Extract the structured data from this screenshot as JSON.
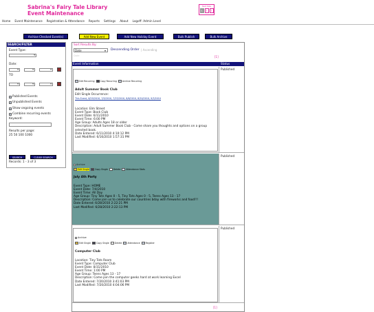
{
  "header": {
    "title_line1": "Sabrina's Fairy Tale Library",
    "title_line2": "Event Maintenance",
    "text_size_label": "Text Size",
    "text_size_options": [
      "S",
      "T",
      "T"
    ]
  },
  "menu": [
    "Home",
    "Event Maintenance",
    "Registration & Attendance",
    "Reports",
    "Settings",
    "About",
    "Logoff: Admin Level"
  ],
  "toolbar": {
    "archive_checked": "Archive Checked Event(s)",
    "add_new": "Add New Event",
    "add_holiday": "Add New Holiday Event",
    "bulk_publish": "Bulk Publish",
    "bulk_archive": "Bulk Archive"
  },
  "sidebar": {
    "title": "SEARCH/FILTER",
    "event_type_label": "Event Type:",
    "date_label": "Date:",
    "to_label": "TO",
    "checks": [
      {
        "label": "Published Events",
        "checked": true
      },
      {
        "label": "Unpublished Events",
        "checked": true
      },
      {
        "label": "Show ongoing events",
        "checked": true
      },
      {
        "label": "Combine recurring events",
        "checked": true
      }
    ],
    "keyword_label": "Keyword:",
    "rpp_label": "Results per page:",
    "rpp_options": "25 50 100 1000",
    "search_btn": "SEARCH",
    "clear_btn": "CLEAR SEARCH",
    "records": "Records: 1 - 3 of 3"
  },
  "sort": {
    "label": "Sort Results By:",
    "selected": "Date",
    "descending": "Descending Order",
    "sep": "|",
    "ascending": "Ascending",
    "date_hint": "Date",
    "pager": "[1]"
  },
  "table": {
    "col_info": "Event Information",
    "col_status": "Status"
  },
  "events": [
    {
      "status": "Published",
      "actions": [
        "Edit Recurring",
        "Copy Recurring",
        "Archive Recurring"
      ],
      "title": "Adult Summer Book Club",
      "edit_single": "Edit Single Occurrence:",
      "occurrences": "This Event, 6/29/2010, 7/9/2010, 7/23/2010, 8/6/2010, 8/20/2010, 9/3/2010",
      "location": "Location: Elm Street",
      "type": "Event Type: Book Club",
      "date": "Event Date: 6/11/2010",
      "time": "Event Time: 6:00 PM",
      "age": "Age Group: Adults Ages 18 or older",
      "desc": "Description: Adult Summer Book Club - Come share you thoughts and options on a group selected book.",
      "entered": "Date Entered: 6/11/2010 4:10:12 PM",
      "modified": "Last Modified: 6/16/2010 1:57:31 PM"
    },
    {
      "status": "Published",
      "archive": "Archive",
      "actions": [
        "Edit Single",
        "Copy Single",
        "Delete",
        "Attendance Stats"
      ],
      "title": "July 4th Party",
      "type": "Event Type: HOME",
      "date": "Event Date: 7/4/2010",
      "time": "Event Time: All Day",
      "age": "Age Group: Tiny Tots Ages 0 - 5, Tiny Tots Ages 0 - 5, Teens Ages 13 - 17",
      "desc": "Description: Come join us to celebrate our countries bday with fireworks and food!!!",
      "entered": "Date Entered: 6/28/2010 2:22:21 PM",
      "modified": "Last Modified: 6/28/2010 2:22:13 PM"
    },
    {
      "status": "Published",
      "archive": "Archive",
      "actions": [
        "Edit Single",
        "Copy Single",
        "Delete",
        "Attendance",
        "Register"
      ],
      "title": "Computer Club",
      "location": "Location: Tiny Tots Room",
      "type": "Event Type: Computer Club",
      "date": "Event Date: 8/31/2010",
      "time": "Event Time: 1:00 PM",
      "age": "Age Group: Teens Ages 13 - 17",
      "desc": "Description: Come join the computer geeks hard at work learning Excel",
      "entered": "Date Entered: 7/20/2010 3:41:03 PM",
      "modified": "Last Modified: 7/20/2010 4:04:06 PM"
    }
  ],
  "colors": {
    "accent": "#e0259a",
    "navy": "#12127a",
    "teal": "#6a9a97",
    "highlight": "#f5f000"
  }
}
